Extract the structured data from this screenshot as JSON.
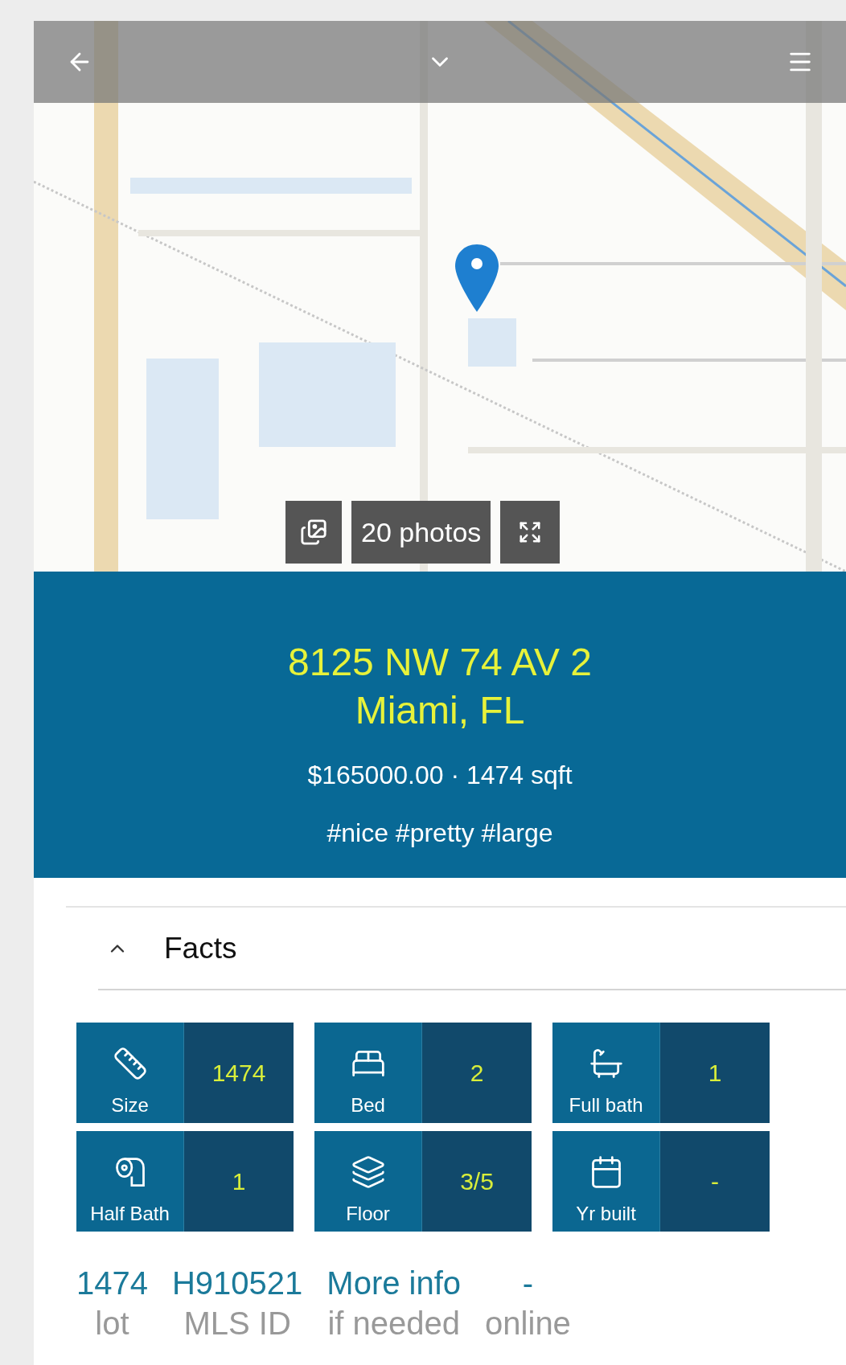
{
  "gallery": {
    "photos_label": "20 photos"
  },
  "listing": {
    "address_line1": "8125 NW 74 AV 2",
    "address_line2": "Miami, FL",
    "summary": "$165000.00 · 1474 sqft",
    "tags": "#nice #pretty #large"
  },
  "facts": {
    "title": "Facts",
    "expanded": true,
    "items": [
      {
        "kind": "size",
        "label": "Size",
        "value": "1474"
      },
      {
        "kind": "bed",
        "label": "Bed",
        "value": "2"
      },
      {
        "kind": "full_bath",
        "label": "Full bath",
        "value": "1"
      },
      {
        "kind": "half_bath",
        "label": "Half Bath",
        "value": "1"
      },
      {
        "kind": "floor",
        "label": "Floor",
        "value": "3/5"
      },
      {
        "kind": "year_built",
        "label": "Yr built",
        "value": "-"
      }
    ]
  },
  "stats": [
    {
      "value": "1474",
      "label": "lot"
    },
    {
      "value": "H910521",
      "label": "MLS ID"
    },
    {
      "value": "More info",
      "label": "if needed"
    },
    {
      "value": "-",
      "label": "online"
    }
  ]
}
